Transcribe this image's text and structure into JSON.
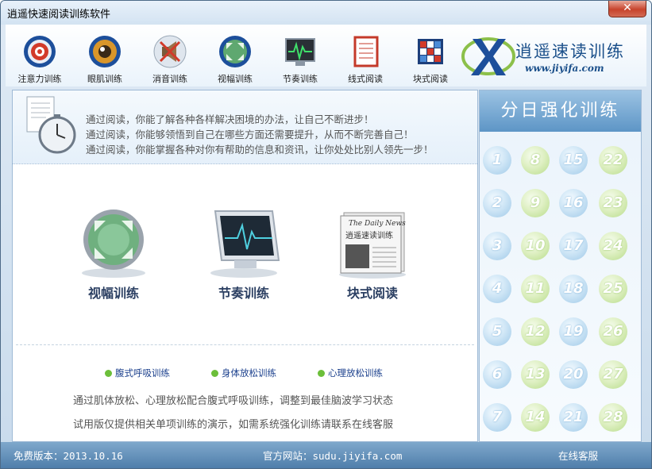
{
  "window": {
    "title": "逍遥快速阅读训练软件",
    "close": "✕"
  },
  "toolbar": [
    {
      "label": "注意力训练",
      "icon": "target-icon"
    },
    {
      "label": "眼肌训练",
      "icon": "eye-icon"
    },
    {
      "label": "消音训练",
      "icon": "mute-speaker-icon"
    },
    {
      "label": "视幅训练",
      "icon": "expand-view-icon"
    },
    {
      "label": "节奏训练",
      "icon": "monitor-pulse-icon"
    },
    {
      "label": "线式阅读",
      "icon": "notebook-icon"
    },
    {
      "label": "块式阅读",
      "icon": "block-grid-icon"
    }
  ],
  "logo": {
    "text": "逍遥速读训练",
    "url": "www.jiyifa.com"
  },
  "banner": [
    "通过阅读，你能了解各种各样解决困境的办法，让自己不断进步！",
    "通过阅读，你能够领悟到自己在哪些方面还需要提升，从而不断完善自己！",
    "通过阅读，你能掌握各种对你有帮助的信息和资讯，让你处处比别人领先一步！"
  ],
  "features": [
    {
      "label": "视幅训练"
    },
    {
      "label": "节奏训练"
    },
    {
      "label": "块式阅读",
      "newspaper_title": "The Daily News",
      "newspaper_text": "逍遥速读训练"
    }
  ],
  "links": [
    "腹式呼吸训练",
    "身体放松训练",
    "心理放松训练"
  ],
  "notes": [
    "通过肌体放松、心理放松配合腹式呼吸训练，调整到最佳脑波学习状态",
    "试用版仅提供相关单项训练的演示，如需系统强化训练请联系在线客服"
  ],
  "side": {
    "title": "分日强化训练",
    "days": [
      [
        "1",
        "8",
        "15",
        "22"
      ],
      [
        "2",
        "9",
        "16",
        "23"
      ],
      [
        "3",
        "10",
        "17",
        "24"
      ],
      [
        "4",
        "11",
        "18",
        "25"
      ],
      [
        "5",
        "12",
        "19",
        "26"
      ],
      [
        "6",
        "13",
        "20",
        "27"
      ],
      [
        "7",
        "14",
        "21",
        "28"
      ]
    ]
  },
  "status": {
    "version": "免费版本：2013.10.16",
    "website": "官方网站：sudu.jiyifa.com",
    "support": "在线客服"
  },
  "colors": {
    "accent": "#4f7eab",
    "link": "#1a3f8c",
    "dot": "#6cbf3a"
  }
}
